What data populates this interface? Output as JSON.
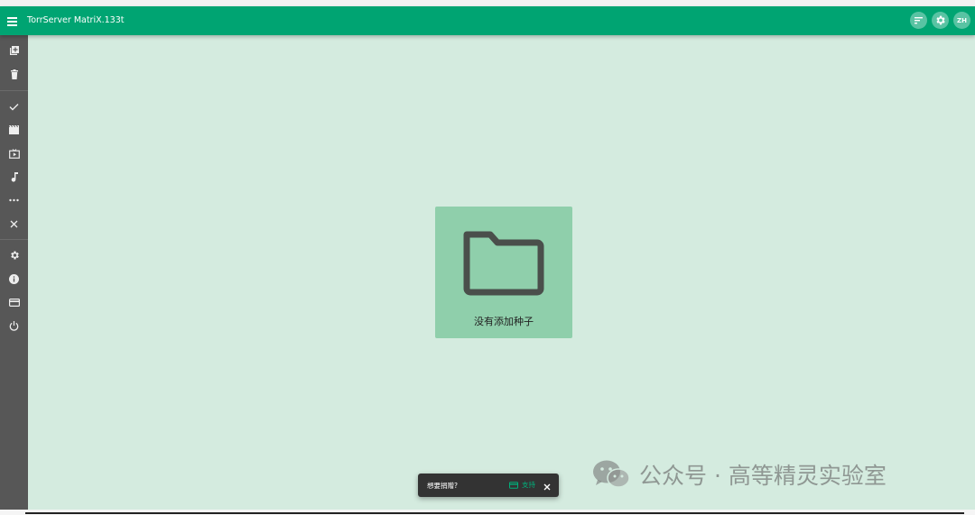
{
  "header": {
    "title": "TorrServer MatriX.133t",
    "menu_icon": "hamburger-menu-icon",
    "actions": [
      {
        "name": "sort-icon"
      },
      {
        "name": "gear-icon"
      },
      {
        "name": "language",
        "label": "ZH"
      }
    ]
  },
  "sidebar": {
    "items": [
      {
        "icon": "add-torrent-icon"
      },
      {
        "icon": "trash-icon"
      },
      {
        "icon": "check-icon"
      },
      {
        "icon": "movie-icon"
      },
      {
        "icon": "tv-icon"
      },
      {
        "icon": "music-icon"
      },
      {
        "icon": "more-dots-icon"
      },
      {
        "icon": "close-icon"
      },
      {
        "icon": "settings-icon"
      },
      {
        "icon": "info-icon"
      },
      {
        "icon": "credit-card-icon"
      },
      {
        "icon": "power-icon"
      }
    ]
  },
  "main": {
    "empty_state": {
      "icon": "folder-icon",
      "text": "没有添加种子"
    }
  },
  "snackbar": {
    "message": "想要捐赠?",
    "action_icon": "credit-card-icon",
    "action_label": "支持",
    "close_icon": "close-icon"
  },
  "watermark": {
    "icon": "wechat-icon",
    "text": "公众号 · 高等精灵实验室"
  },
  "colors": {
    "primary": "#00a472",
    "background": "#d4ebdf",
    "sidebar": "#575757",
    "card": "#8fcfab",
    "snackbar": "#333333",
    "accent": "#00b07b"
  }
}
